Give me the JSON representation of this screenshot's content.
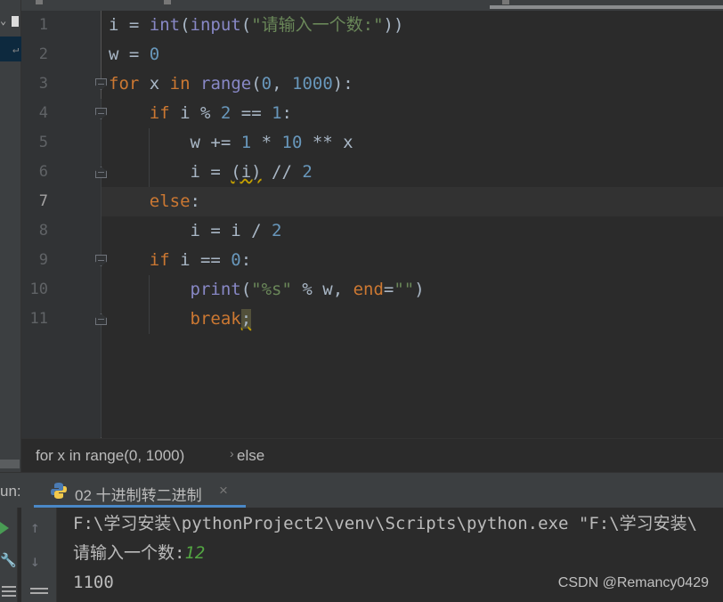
{
  "editor": {
    "current_line": 7,
    "lines": [
      {
        "n": "1",
        "code": "i = int(input(\"请输入一个数:\"))"
      },
      {
        "n": "2",
        "code": "w = 0"
      },
      {
        "n": "3",
        "code": "for x in range(0, 1000):"
      },
      {
        "n": "4",
        "code": "    if i % 2 == 1:"
      },
      {
        "n": "5",
        "code": "        w += 1 * 10 ** x"
      },
      {
        "n": "6",
        "code": "        i = (i) // 2"
      },
      {
        "n": "7",
        "code": "    else:"
      },
      {
        "n": "8",
        "code": "        i = i / 2"
      },
      {
        "n": "9",
        "code": "    if i == 0:"
      },
      {
        "n": "10",
        "code": "        print(\"%s\" % w, end=\"\")"
      },
      {
        "n": "11",
        "code": "        break;"
      }
    ]
  },
  "breadcrumb": {
    "item1": "for x in range(0, 1000)",
    "separator": "›",
    "item2": "else"
  },
  "run_panel": {
    "label": "un:",
    "tab_label": "02 十进制转二进制",
    "close": "×"
  },
  "console": {
    "line1": "F:\\学习安装\\pythonProject2\\venv\\Scripts\\python.exe \"F:\\学习安装\\",
    "prompt": "请输入一个数:",
    "input_value": "12",
    "output": "1100"
  },
  "watermark": "CSDN @Remancy0429",
  "colors": {
    "keyword": "#cc7832",
    "builtin": "#8888c6",
    "string": "#6a8759",
    "number": "#6897bb",
    "accent": "#4a88c7"
  }
}
